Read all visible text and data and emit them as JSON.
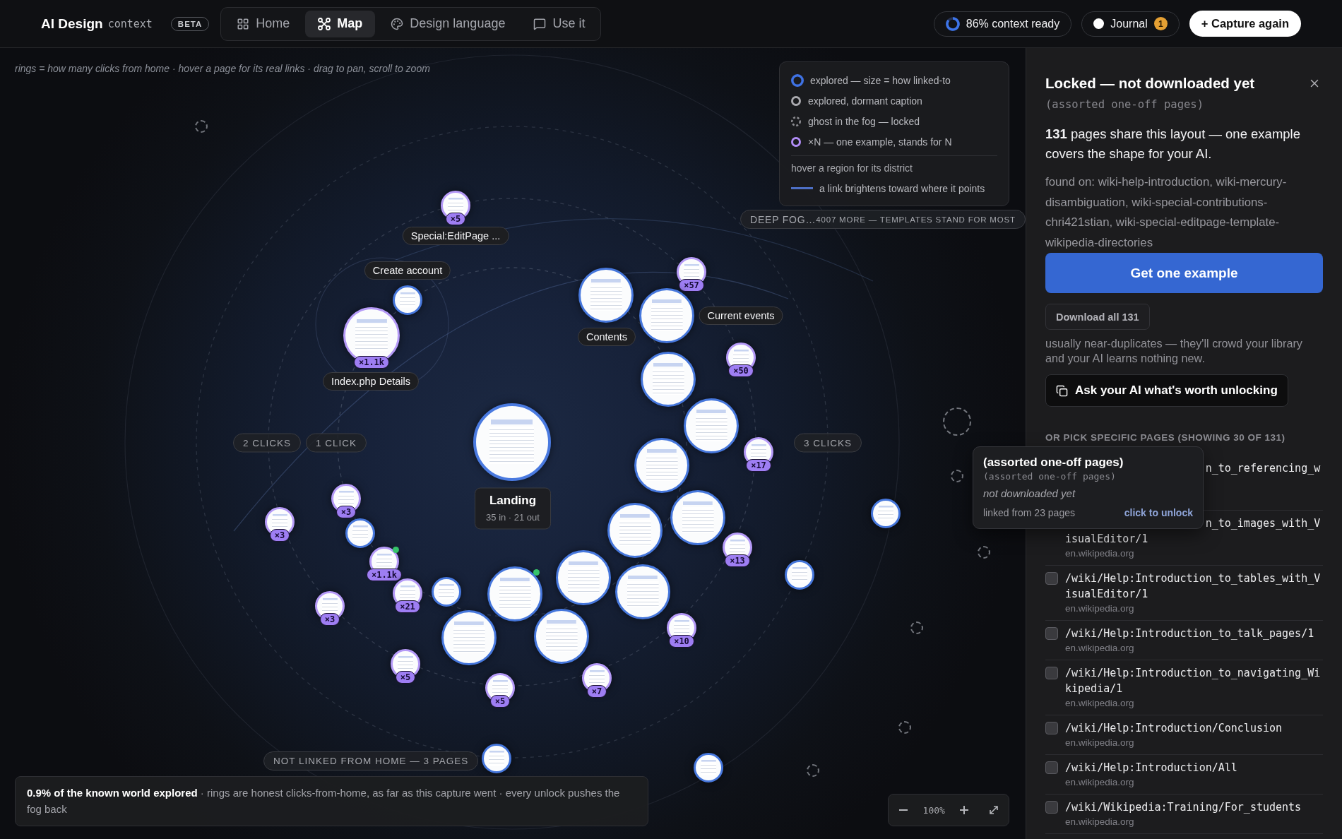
{
  "header": {
    "brand": "AI Design",
    "brand_suffix": "context",
    "badge": "BETA",
    "nav": [
      {
        "label": "Home",
        "selected": false
      },
      {
        "label": "Map",
        "selected": true
      },
      {
        "label": "Design language",
        "selected": false
      },
      {
        "label": "Use it",
        "selected": false
      }
    ],
    "context": {
      "label": "86% context ready"
    },
    "journal": {
      "label": "Journal",
      "count": "1"
    },
    "capture": "+ Capture again"
  },
  "map": {
    "hint": "rings = how many clicks from home · hover a page for its real links · drag to pan, scroll to zoom",
    "legend": {
      "items": [
        {
          "kind": "explored",
          "text": "explored — size = how linked-to"
        },
        {
          "kind": "dormant",
          "text": "explored, dormant caption"
        },
        {
          "kind": "ghost",
          "text": "ghost in the fog — locked"
        },
        {
          "kind": "template",
          "text": "×N — one example, stands for N"
        }
      ],
      "note": "hover a region for its district",
      "link_text": "a link brightens toward where it points"
    },
    "fog": {
      "label": "DEEP FOG…",
      "detail": "4007 MORE — TEMPLATES STAND FOR MOST"
    },
    "ring_labels": [
      "2 CLICKS",
      "1 CLICK",
      "3 CLICKS"
    ],
    "nodes": [
      {
        "kind": "ghost"
      },
      {
        "kind": "template",
        "count": "×5",
        "label": "Special:EditPage ...",
        "flagged": false
      },
      {
        "kind": "template",
        "count": "×57",
        "flagged": false
      },
      {
        "kind": "page",
        "label": "Create account",
        "flagged": false
      },
      {
        "kind": "page",
        "label": "Contents",
        "flagged": false
      },
      {
        "kind": "page",
        "label": "Current events",
        "flagged": false
      },
      {
        "kind": "template",
        "count": "×1.1k",
        "label": "Index.php Details",
        "flagged": false
      },
      {
        "kind": "template",
        "count": "×50",
        "flagged": false
      },
      {
        "kind": "page",
        "flagged": false
      },
      {
        "kind": "ghost"
      },
      {
        "kind": "page",
        "flagged": false
      },
      {
        "kind": "landing",
        "label": "Landing",
        "sublabel": "35 in · 21 out",
        "flagged": false
      },
      {
        "kind": "template",
        "count": "×17",
        "flagged": false
      },
      {
        "kind": "page",
        "flagged": false
      },
      {
        "kind": "ghost"
      },
      {
        "kind": "template",
        "count": "×3",
        "flagged": false
      },
      {
        "kind": "page",
        "flagged": false
      },
      {
        "kind": "template",
        "count": "×3",
        "flagged": false
      },
      {
        "kind": "page",
        "flagged": false
      },
      {
        "kind": "page",
        "flagged": false
      },
      {
        "kind": "page",
        "flagged": false
      },
      {
        "kind": "template",
        "count": "×13",
        "flagged": false
      },
      {
        "kind": "ghost"
      },
      {
        "kind": "template",
        "count": "×1.1k",
        "flagged": true
      },
      {
        "kind": "page",
        "flagged": false
      },
      {
        "kind": "page",
        "flagged": false
      },
      {
        "kind": "page",
        "flagged": false
      },
      {
        "kind": "page",
        "flagged": false
      },
      {
        "kind": "template",
        "count": "×21",
        "flagged": false
      },
      {
        "kind": "page",
        "flagged": true
      },
      {
        "kind": "template",
        "count": "×3",
        "flagged": false
      },
      {
        "kind": "ghost"
      },
      {
        "kind": "template",
        "count": "×10",
        "flagged": false
      },
      {
        "kind": "page",
        "flagged": false
      },
      {
        "kind": "page",
        "flagged": false
      },
      {
        "kind": "template",
        "count": "×5",
        "flagged": false
      },
      {
        "kind": "template",
        "count": "×7",
        "flagged": false
      },
      {
        "kind": "template",
        "count": "×5",
        "flagged": false
      },
      {
        "kind": "ghost"
      },
      {
        "kind": "page",
        "flagged": false
      },
      {
        "kind": "page",
        "flagged": false
      },
      {
        "kind": "ghost"
      }
    ],
    "orphans": "NOT LINKED FROM HOME — 3 PAGES",
    "caption": "**0.9% of the known world explored** · rings are honest clicks-from-home, as far as this capture went · every unlock pushes the fog back",
    "zoom": "100%",
    "tooltip": {
      "title": "(assorted one-off pages)",
      "subtitle": "(assorted one-off pages)",
      "status": "not downloaded yet",
      "links": "linked from 23 pages",
      "action": "click to unlock"
    }
  },
  "panel": {
    "title": "Locked — not downloaded yet",
    "subtitle": "(assorted one-off pages)",
    "summary": "**131** pages share this layout — one example covers the shape for your AI.",
    "found_on": "found on: wiki-help-introduction, wiki-mercury-disambiguation, wiki-special-contributions-chri421stian, wiki-special-editpage-template-wikipedia-directories",
    "primary": "Get one example",
    "download": "Download all 131",
    "note": "usually near-duplicates — they'll crowd your library and your AI learns nothing new.",
    "ask": "Ask your AI what's worth unlocking",
    "list_heading": "OR PICK SPECIFIC PAGES (SHOWING 30 OF 131)",
    "pages": [
      {
        "kind": "partial",
        "path": "n_to_referencing_w"
      },
      {
        "kind": "partial",
        "path": "n_to_images_with_VisualEditor/1",
        "domain": "en.wikipedia.org"
      },
      {
        "kind": "page",
        "path": "/wiki/Help:Introduction_to_tables_with_VisualEditor/1",
        "domain": "en.wikipedia.org",
        "checked": false
      },
      {
        "kind": "page",
        "path": "/wiki/Help:Introduction_to_talk_pages/1",
        "domain": "en.wikipedia.org",
        "checked": false
      },
      {
        "kind": "page",
        "path": "/wiki/Help:Introduction_to_navigating_Wikipedia/1",
        "domain": "en.wikipedia.org",
        "checked": false
      },
      {
        "kind": "page",
        "path": "/wiki/Help:Introduction/Conclusion",
        "domain": "en.wikipedia.org",
        "checked": false
      },
      {
        "kind": "page",
        "path": "/wiki/Help:Introduction/All",
        "domain": "en.wikipedia.org",
        "checked": false
      },
      {
        "kind": "page",
        "path": "/wiki/Wikipedia:Training/For_students",
        "domain": "en.wikipedia.org",
        "checked": false
      }
    ]
  }
}
